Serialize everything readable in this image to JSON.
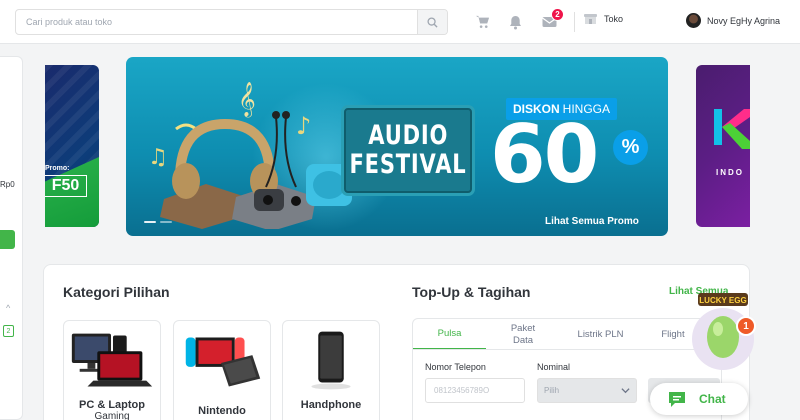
{
  "header": {
    "search_placeholder": "Cari produk atau toko",
    "cart_icon": "cart-icon",
    "bell_icon": "bell-icon",
    "inbox_icon": "inbox-icon",
    "inbox_badge": "2",
    "shop_label": "Toko",
    "user_name": "Novy EgHy Agrina"
  },
  "left_panel": {
    "rp_text": "Rp0",
    "count_badge": "2"
  },
  "side_banner_left": {
    "promo_label": "Promo:",
    "promo_code": "F50"
  },
  "main_banner": {
    "title_line1": "AUDIO",
    "title_line2": "FESTIVAL",
    "discount_label_bold": "DISKON",
    "discount_label_light": "HINGGA",
    "discount_value": "60",
    "percent_sign": "%",
    "link_text": "Lihat Semua Promo"
  },
  "side_banner_right": {
    "brand_text": "INDO"
  },
  "kategori": {
    "title": "Kategori Pilihan",
    "items": [
      {
        "label": "PC & Laptop",
        "sub": "Gaming"
      },
      {
        "label": "Nintendo",
        "sub": ""
      },
      {
        "label": "Handphone",
        "sub": ""
      }
    ]
  },
  "topup": {
    "title": "Top-Up & Tagihan",
    "see_all": "Lihat Semua",
    "tabs": [
      "Pulsa",
      "Paket Data",
      "Listrik PLN",
      "Flight"
    ],
    "active_tab": "Pulsa",
    "phone_label": "Nomor Telepon",
    "phone_placeholder": "08123456789O",
    "nominal_label": "Nominal",
    "nominal_value": "Pilih"
  },
  "floating": {
    "egg_label": "LUCKY EGG",
    "egg_badge": "1",
    "chat_label": "Chat"
  },
  "colors": {
    "brand_green": "#42b549",
    "badge_red": "#ef144a",
    "banner_teal": "#0e8db0"
  }
}
